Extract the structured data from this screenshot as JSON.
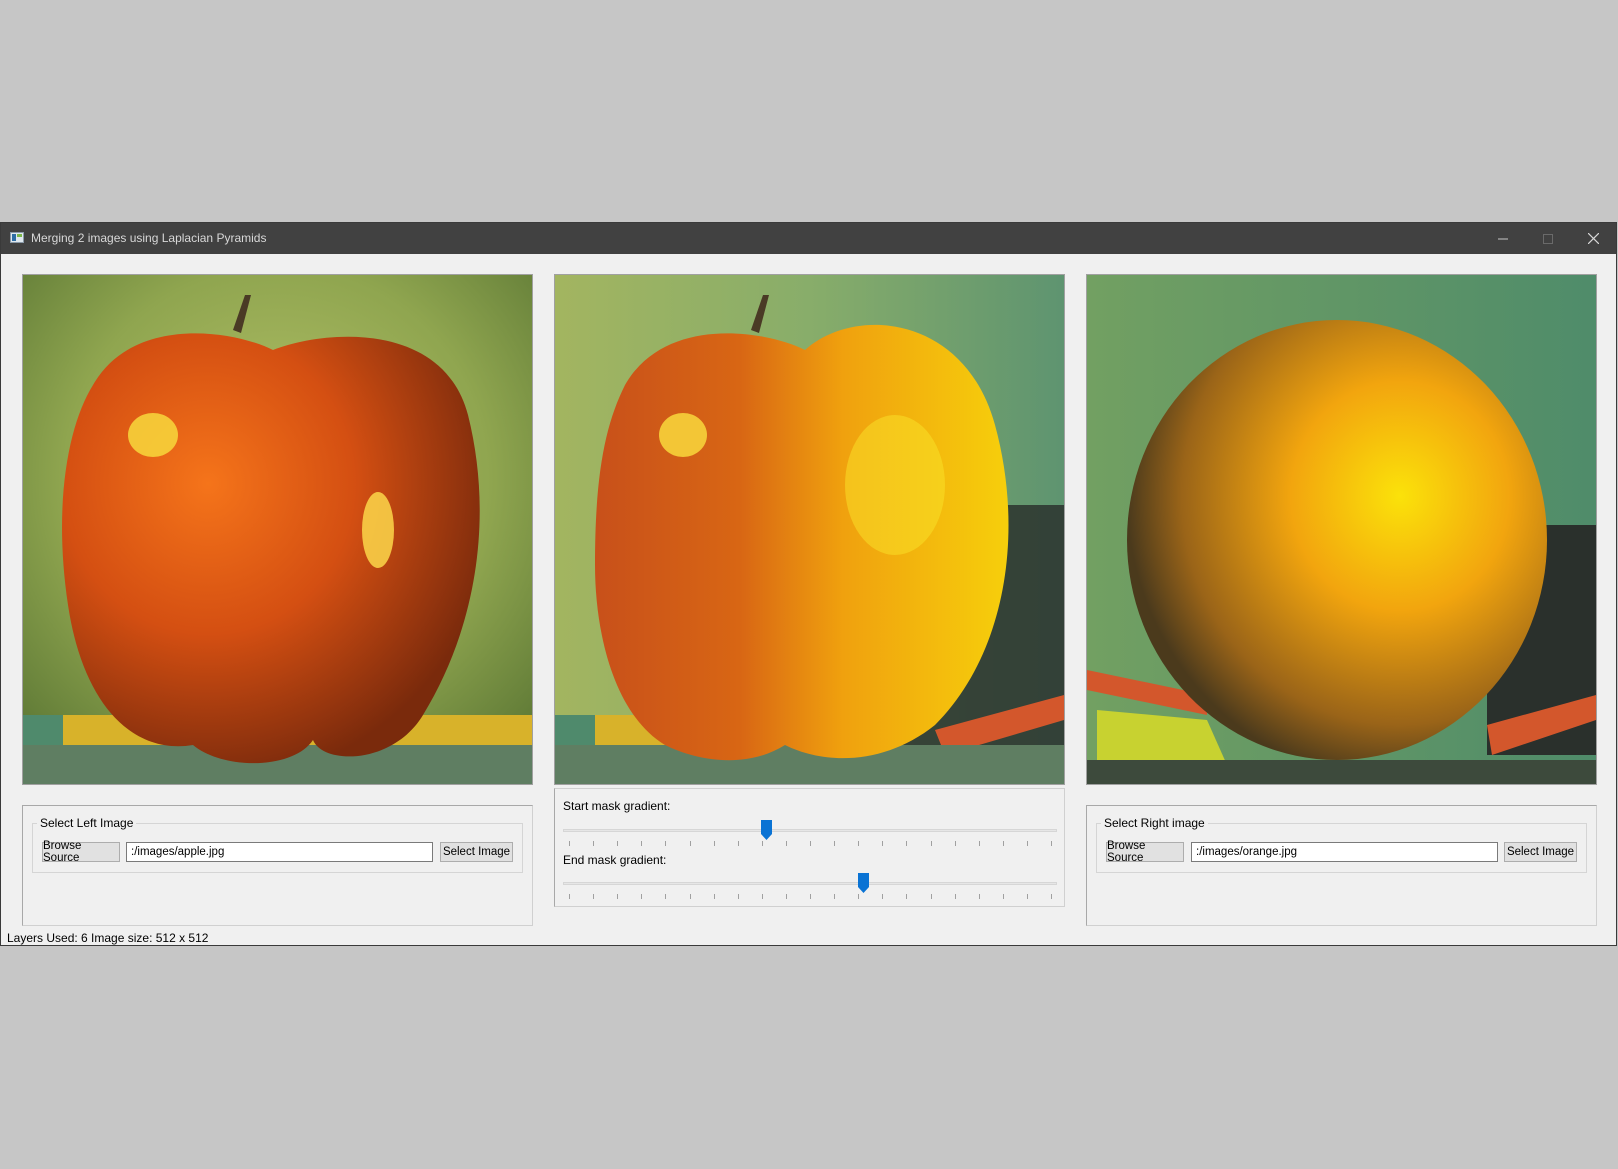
{
  "window": {
    "title": "Merging 2 images using Laplacian Pyramids",
    "controls": [
      "minimize-icon",
      "maximize-icon",
      "close-icon"
    ]
  },
  "images": {
    "left": "apple",
    "center": "apple-orange blend",
    "right": "orange"
  },
  "left_group": {
    "title": "Select Left Image",
    "browse_label": "Browse Source",
    "path_value": ":/images/apple.jpg",
    "select_label": "Select Image"
  },
  "sliders": {
    "start_label": "Start mask gradient:",
    "start_value": 0.41,
    "end_label": "End mask gradient:",
    "end_value": 0.61,
    "accent": "#0a73d4"
  },
  "right_group": {
    "title": "Select Right image",
    "browse_label": "Browse Source",
    "path_value": ":/images/orange.jpg",
    "select_label": "Select Image"
  },
  "status": {
    "text": "Layers Used: 6  Image size: 512 x 512"
  }
}
